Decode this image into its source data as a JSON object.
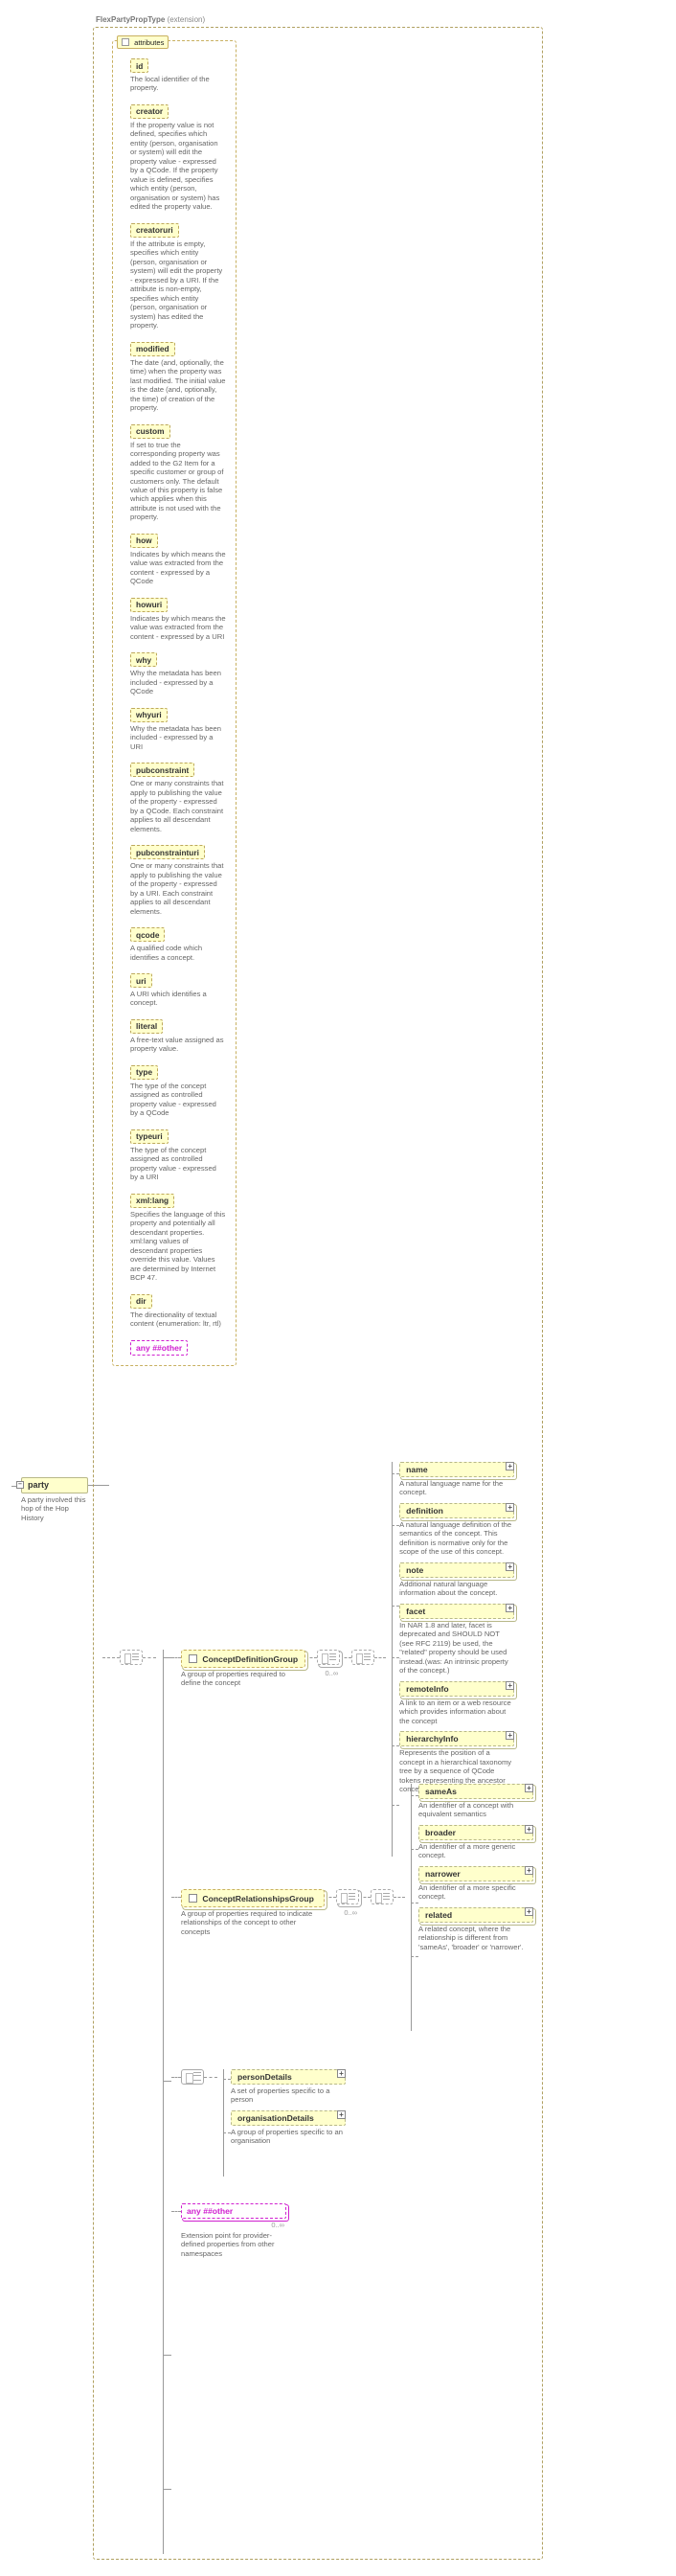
{
  "ext_label_bold": "FlexPartyPropType",
  "ext_label_suffix": "(extension)",
  "root": {
    "name": "party",
    "doc": "A party involved this hop of the Hop History"
  },
  "attrs_head": "attributes",
  "attrs": [
    {
      "name": "id",
      "doc": "The local identifier of the property."
    },
    {
      "name": "creator",
      "doc": "If the property value is not defined, specifies which entity (person, organisation or system) will edit the property value - expressed by a QCode. If the property value is defined, specifies which entity (person, organisation or system) has edited the property value."
    },
    {
      "name": "creatoruri",
      "doc": "If the attribute is empty, specifies which entity (person, organisation or system) will edit the property - expressed by a URI. If the attribute is non-empty, specifies which entity (person, organisation or system) has edited the property."
    },
    {
      "name": "modified",
      "doc": "The date (and, optionally, the time) when the property was last modified. The initial value is the date (and, optionally, the time) of creation of the property."
    },
    {
      "name": "custom",
      "doc": "If set to true the corresponding property was added to the G2 Item for a specific customer or group of customers only. The default value of this property is false which applies when this attribute is not used with the property."
    },
    {
      "name": "how",
      "doc": "Indicates by which means the value was extracted from the content - expressed by a QCode"
    },
    {
      "name": "howuri",
      "doc": "Indicates by which means the value was extracted from the content - expressed by a URI"
    },
    {
      "name": "why",
      "doc": "Why the metadata has been included - expressed by a QCode"
    },
    {
      "name": "whyuri",
      "doc": "Why the metadata has been included - expressed by a URI"
    },
    {
      "name": "pubconstraint",
      "doc": "One or many constraints that apply to publishing the value of the property - expressed by a QCode. Each constraint applies to all descendant elements."
    },
    {
      "name": "pubconstrainturi",
      "doc": "One or many constraints that apply to publishing the value of the property - expressed by a URI. Each constraint applies to all descendant elements."
    },
    {
      "name": "qcode",
      "doc": "A qualified code which identifies a concept."
    },
    {
      "name": "uri",
      "doc": "A URI which identifies a concept."
    },
    {
      "name": "literal",
      "doc": "A free-text value assigned as property value."
    },
    {
      "name": "type",
      "doc": "The type of the concept assigned as controlled property value - expressed by a QCode"
    },
    {
      "name": "typeuri",
      "doc": "The type of the concept assigned as controlled property value - expressed by a URI"
    },
    {
      "name": "xml:lang",
      "doc": "Specifies the language of this property and potentially all descendant properties. xml:lang values of descendant properties override this value. Values are determined by Internet BCP 47."
    },
    {
      "name": "dir",
      "doc": "The directionality of textual content (enumeration: ltr, rtl)"
    }
  ],
  "any_other": "any ##other",
  "occ_0inf": "0..∞",
  "groups": {
    "def": {
      "name": "ConceptDefinitionGroup",
      "doc": "A group of properties required to define the concept"
    },
    "rel": {
      "name": "ConceptRelationshipsGroup",
      "doc": "A group of properties required to indicate relationships of the concept to other concepts"
    }
  },
  "def_children": [
    {
      "name": "name",
      "doc": "A natural language name for the concept."
    },
    {
      "name": "definition",
      "doc": "A natural language definition of the semantics of the concept. This definition is normative only for the scope of the use of this concept."
    },
    {
      "name": "note",
      "doc": "Additional natural language information about the concept."
    },
    {
      "name": "facet",
      "doc": "In NAR 1.8 and later, facet is deprecated and SHOULD NOT (see RFC 2119) be used, the \"related\" property should be used instead.(was: An intrinsic property of the concept.)"
    },
    {
      "name": "remoteInfo",
      "doc": "A link to an item or a web resource which provides information about the concept"
    },
    {
      "name": "hierarchyInfo",
      "doc": "Represents the position of a concept in a hierarchical taxonomy tree by a sequence of QCode tokens representing the ancestor concepts and this concept"
    }
  ],
  "rel_children": [
    {
      "name": "sameAs",
      "doc": "An identifier of a concept with equivalent semantics"
    },
    {
      "name": "broader",
      "doc": "An identifier of a more generic concept."
    },
    {
      "name": "narrower",
      "doc": "An identifier of a more specific concept."
    },
    {
      "name": "related",
      "doc": "A related concept, where the relationship is different from 'sameAs', 'broader' or 'narrower'."
    }
  ],
  "entity_children": [
    {
      "name": "personDetails",
      "doc": "A set of properties specific to a person"
    },
    {
      "name": "organisationDetails",
      "doc": "A group of properties specific to an organisation"
    }
  ],
  "ext_point": {
    "name": "any ##other",
    "doc": "Extension point for provider-defined properties from other namespaces"
  }
}
